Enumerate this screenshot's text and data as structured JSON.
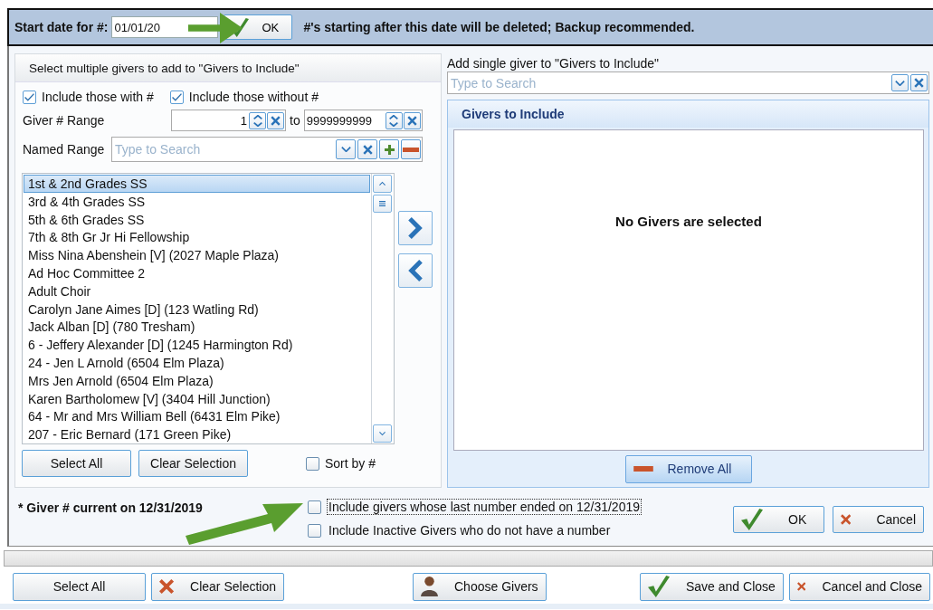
{
  "header": {
    "label": "Start date for #:",
    "date_value": "01/01/20",
    "ok_button": "OK",
    "note": "#'s starting after this date will be deleted; Backup recommended."
  },
  "left_panel": {
    "title": "Select  multiple givers to add to \"Givers to Include\"",
    "include_with": {
      "label": "Include those with #",
      "checked": true
    },
    "include_without": {
      "label": "Include those without #",
      "checked": true
    },
    "range": {
      "label": "Giver # Range",
      "from": "1",
      "to_label": "to",
      "to": "9999999999"
    },
    "named_range": {
      "label": "Named Range",
      "placeholder": "Type to Search"
    },
    "list": [
      {
        "text": "1st & 2nd Grades SS",
        "selected": true
      },
      {
        "text": "3rd & 4th Grades SS",
        "selected": false
      },
      {
        "text": "5th & 6th Grades SS",
        "selected": false
      },
      {
        "text": "7th & 8th Gr Jr Hi Fellowship",
        "selected": false
      },
      {
        "text": "Miss Nina Abenshein [V] (2027 Maple Plaza)",
        "selected": false
      },
      {
        "text": "Ad Hoc Committee 2",
        "selected": false
      },
      {
        "text": "Adult Choir",
        "selected": false
      },
      {
        "text": "Carolyn Jane Aimes [D] (123 Watling Rd)",
        "selected": false
      },
      {
        "text": "Jack Alban [D] (780 Tresham)",
        "selected": false
      },
      {
        "text": "6 - Jeffery Alexander [D] (1245 Harmington Rd)",
        "selected": false
      },
      {
        "text": "24 - Jen L Arnold (6504 Elm Plaza)",
        "selected": false
      },
      {
        "text": "Mrs Jen Arnold (6504 Elm Plaza)",
        "selected": false
      },
      {
        "text": "Karen Bartholomew [V] (3404 Hill Junction)",
        "selected": false
      },
      {
        "text": "64 - Mr and Mrs William Bell (6431 Elm Pike)",
        "selected": false
      },
      {
        "text": "207 - Eric Bernard (171 Green Pike)",
        "selected": false
      }
    ],
    "select_all": "Select All",
    "clear_selection": "Clear Selection",
    "sort_by": {
      "label": "Sort by #",
      "checked": false
    }
  },
  "right_panel": {
    "label": "Add single giver to \"Givers to Include\"",
    "placeholder": "Type to Search",
    "title": "Givers to Include",
    "empty_message": "No Givers are selected",
    "remove_all": "Remove All"
  },
  "footer": {
    "current_note": "* Giver # current on  12/31/2019",
    "options": [
      {
        "label": "Include givers whose last number ended on 12/31/2019",
        "checked": false,
        "focused": true
      },
      {
        "label": "Include Inactive Givers who do not have a number",
        "checked": false,
        "focused": false
      }
    ],
    "ok": "OK",
    "cancel": "Cancel"
  },
  "bottom_buttons": [
    {
      "label": "Select All"
    },
    {
      "label": "Clear Selection"
    },
    {
      "label": "Choose Givers"
    },
    {
      "label": "Save and Close"
    },
    {
      "label": "Cancel and Close"
    }
  ]
}
